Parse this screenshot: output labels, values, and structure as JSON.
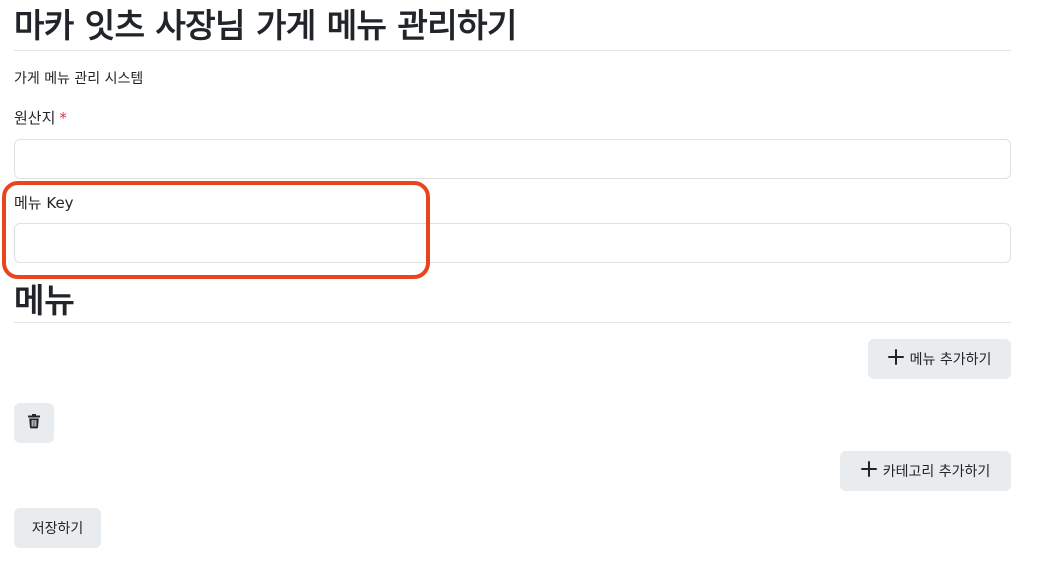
{
  "header": {
    "title": "마카 잇츠 사장님 가게 메뉴 관리하기",
    "subtitle": "가게 메뉴 관리 시스템"
  },
  "form": {
    "origin_label": "원산지",
    "required_mark": "*",
    "origin_value": "",
    "menu_key_label": "메뉴 Key",
    "menu_key_value": ""
  },
  "menu_section": {
    "title": "메뉴",
    "add_menu_label": "메뉴 추가하기",
    "add_category_label": "카테고리 추가하기",
    "delete_icon": "trash-icon"
  },
  "footer": {
    "save_label": "저장하기"
  },
  "colors": {
    "highlight": "#e8451e",
    "required": "#dc3545",
    "button_bg": "#e9ecef"
  }
}
